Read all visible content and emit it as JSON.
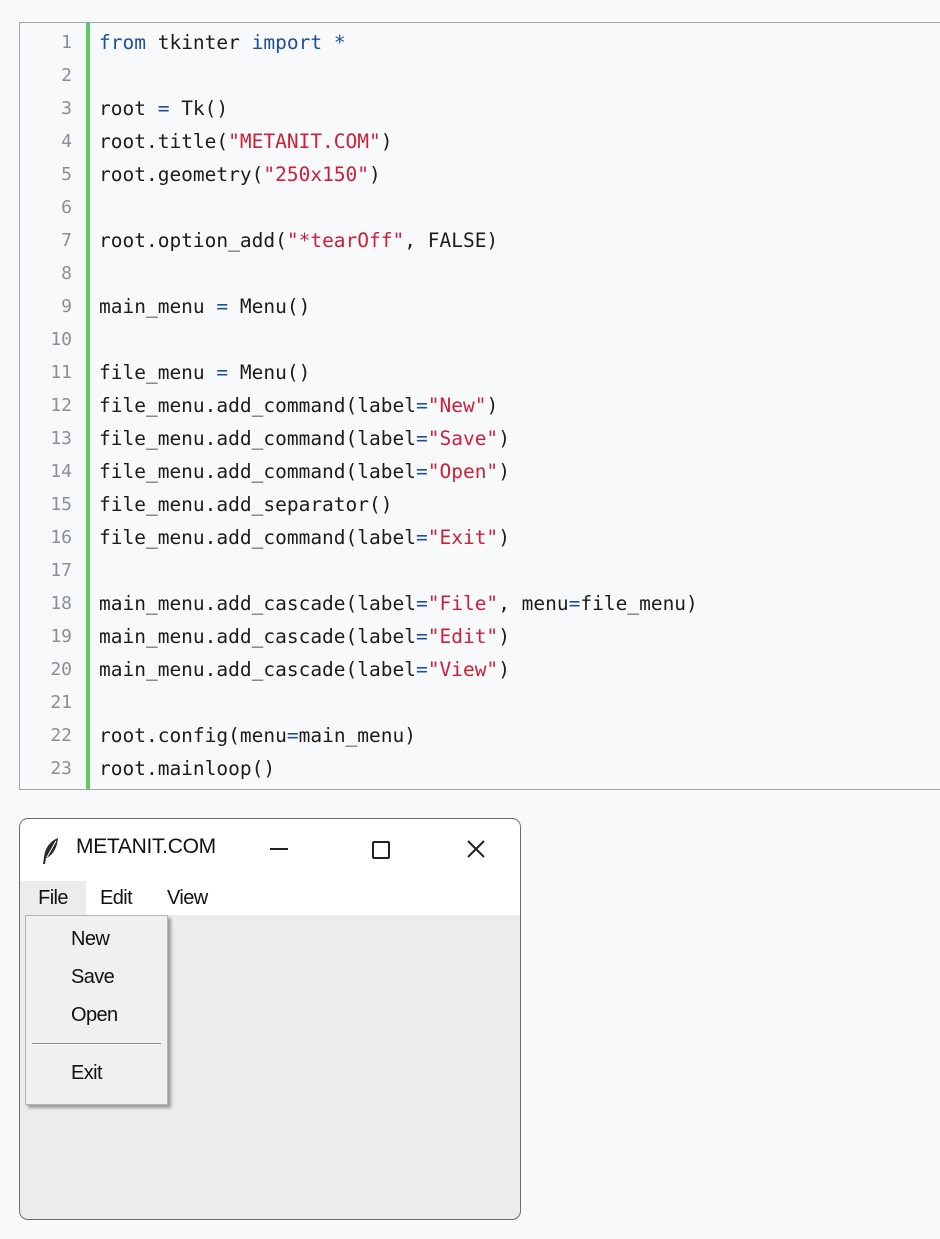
{
  "code": {
    "lines": [
      {
        "n": "1",
        "tokens": [
          {
            "t": "from",
            "c": "kw"
          },
          {
            "t": " tkinter "
          },
          {
            "t": "import",
            "c": "kw"
          },
          {
            "t": " *",
            "c": "op"
          }
        ]
      },
      {
        "n": "2",
        "tokens": []
      },
      {
        "n": "3",
        "tokens": [
          {
            "t": "root "
          },
          {
            "t": "=",
            "c": "op"
          },
          {
            "t": " Tk()"
          }
        ]
      },
      {
        "n": "4",
        "tokens": [
          {
            "t": "root.title("
          },
          {
            "t": "\"METANIT.COM\"",
            "c": "str"
          },
          {
            "t": ")"
          }
        ]
      },
      {
        "n": "5",
        "tokens": [
          {
            "t": "root.geometry("
          },
          {
            "t": "\"250x150\"",
            "c": "str"
          },
          {
            "t": ")"
          }
        ]
      },
      {
        "n": "6",
        "tokens": []
      },
      {
        "n": "7",
        "tokens": [
          {
            "t": "root.option_add("
          },
          {
            "t": "\"*tearOff\"",
            "c": "str"
          },
          {
            "t": ", FALSE)"
          }
        ]
      },
      {
        "n": "8",
        "tokens": []
      },
      {
        "n": "9",
        "tokens": [
          {
            "t": "main_menu "
          },
          {
            "t": "=",
            "c": "op"
          },
          {
            "t": " Menu()"
          }
        ]
      },
      {
        "n": "10",
        "tokens": []
      },
      {
        "n": "11",
        "tokens": [
          {
            "t": "file_menu "
          },
          {
            "t": "=",
            "c": "op"
          },
          {
            "t": " Menu()"
          }
        ]
      },
      {
        "n": "12",
        "tokens": [
          {
            "t": "file_menu.add_command(label"
          },
          {
            "t": "=",
            "c": "op"
          },
          {
            "t": "\"New\"",
            "c": "str"
          },
          {
            "t": ")"
          }
        ]
      },
      {
        "n": "13",
        "tokens": [
          {
            "t": "file_menu.add_command(label"
          },
          {
            "t": "=",
            "c": "op"
          },
          {
            "t": "\"Save\"",
            "c": "str"
          },
          {
            "t": ")"
          }
        ]
      },
      {
        "n": "14",
        "tokens": [
          {
            "t": "file_menu.add_command(label"
          },
          {
            "t": "=",
            "c": "op"
          },
          {
            "t": "\"Open\"",
            "c": "str"
          },
          {
            "t": ")"
          }
        ]
      },
      {
        "n": "15",
        "tokens": [
          {
            "t": "file_menu.add_separator()"
          }
        ]
      },
      {
        "n": "16",
        "tokens": [
          {
            "t": "file_menu.add_command(label"
          },
          {
            "t": "=",
            "c": "op"
          },
          {
            "t": "\"Exit\"",
            "c": "str"
          },
          {
            "t": ")"
          }
        ]
      },
      {
        "n": "17",
        "tokens": []
      },
      {
        "n": "18",
        "tokens": [
          {
            "t": "main_menu.add_cascade(label"
          },
          {
            "t": "=",
            "c": "op"
          },
          {
            "t": "\"File\"",
            "c": "str"
          },
          {
            "t": ", menu"
          },
          {
            "t": "=",
            "c": "op"
          },
          {
            "t": "file_menu)"
          }
        ]
      },
      {
        "n": "19",
        "tokens": [
          {
            "t": "main_menu.add_cascade(label"
          },
          {
            "t": "=",
            "c": "op"
          },
          {
            "t": "\"Edit\"",
            "c": "str"
          },
          {
            "t": ")"
          }
        ]
      },
      {
        "n": "20",
        "tokens": [
          {
            "t": "main_menu.add_cascade(label"
          },
          {
            "t": "=",
            "c": "op"
          },
          {
            "t": "\"View\"",
            "c": "str"
          },
          {
            "t": ")"
          }
        ]
      },
      {
        "n": "21",
        "tokens": []
      },
      {
        "n": "22",
        "tokens": [
          {
            "t": "root.config(menu"
          },
          {
            "t": "=",
            "c": "op"
          },
          {
            "t": "main_menu)"
          }
        ]
      },
      {
        "n": "23",
        "tokens": [
          {
            "t": "root.mainloop()"
          }
        ]
      }
    ]
  },
  "window": {
    "icon": "feather-icon",
    "title": "METANIT.COM",
    "menubar": [
      "File",
      "Edit",
      "View"
    ],
    "file_menu": {
      "items": [
        "New",
        "Save",
        "Open"
      ],
      "after_separator": [
        "Exit"
      ]
    }
  },
  "colors": {
    "keyword": "#1f4f9c",
    "string": "#cc1f3a",
    "gutter_accent": "#5ec95e",
    "page_bg": "#f8f9fa",
    "window_bg": "#ececec"
  }
}
